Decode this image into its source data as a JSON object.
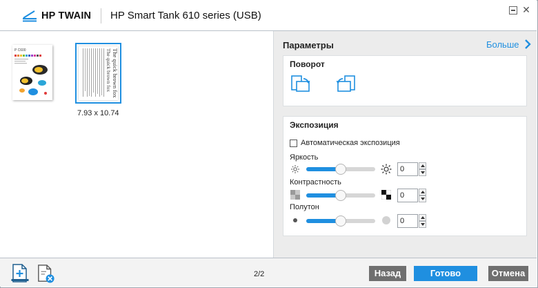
{
  "app": {
    "logo_text": "HP TWAIN",
    "title": "HP Smart Tank 610 series (USB)"
  },
  "preview": {
    "thumb1_label": "P C600",
    "thumb2_text": "The quick brown fox",
    "selected_dimensions": "7.93 x 10.74"
  },
  "panel": {
    "title": "Параметры",
    "more_label": "Больше",
    "rotation": {
      "title": "Поворот"
    },
    "exposure": {
      "title": "Экспозиция",
      "auto_label": "Автоматическая экспозиция",
      "auto_checked": false,
      "brightness": {
        "label": "Яркость",
        "value": "0",
        "level": 0.5
      },
      "contrast": {
        "label": "Контрастность",
        "value": "0",
        "level": 0.5
      },
      "halftone": {
        "label": "Полутон",
        "value": "0",
        "level": 0.5
      }
    }
  },
  "footer": {
    "page_indicator": "2/2",
    "back_label": "Назад",
    "done_label": "Готово",
    "cancel_label": "Отмена"
  },
  "colors": {
    "accent": "#1f8fe0",
    "secondary_button": "#6f6f6f",
    "panel_bg": "#ececec"
  }
}
